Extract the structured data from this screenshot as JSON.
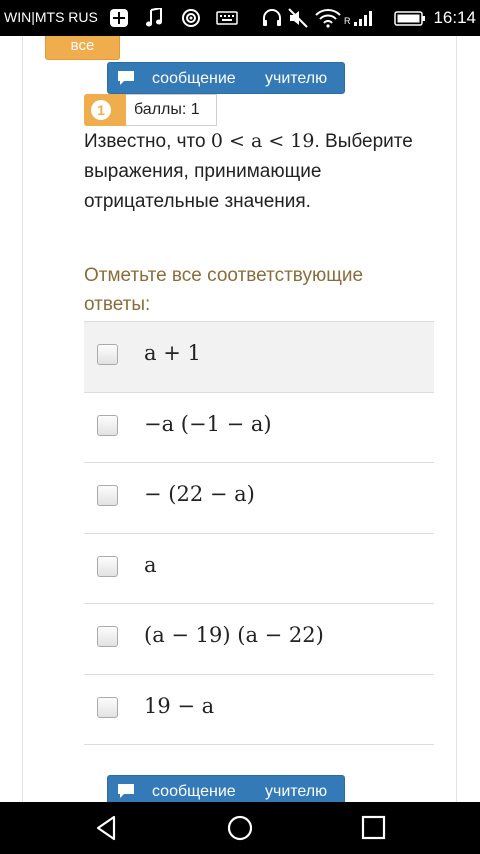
{
  "status_bar": {
    "carrier": "WIN|MTS RUS",
    "time": "16:14",
    "icons": [
      "add-icon",
      "music-icon",
      "target-icon",
      "keyboard-icon",
      "headphones-icon",
      "mute-icon",
      "wifi-icon",
      "signal-icon",
      "battery-icon"
    ]
  },
  "toolbar": {
    "all_label": "все"
  },
  "message_button": {
    "word1": "сообщение",
    "word2": "учителю",
    "icon": "comment-icon"
  },
  "question": {
    "number": "1",
    "points": "баллы: 1",
    "text_before": "Известно, что ",
    "condition": "0 < a < 19",
    "text_after": ". Выберите выражения, принимающие отрицательные значения."
  },
  "instruction": "Отметьте все соответствующие ответы:",
  "answers": [
    {
      "label": "a + 1",
      "checked": false
    },
    {
      "label": "−a (−1 − a)",
      "checked": false
    },
    {
      "label": "− (22 − a)",
      "checked": false
    },
    {
      "label": "a",
      "checked": false
    },
    {
      "label": "(a − 19) (a − 22)",
      "checked": false
    },
    {
      "label": "19 − a",
      "checked": false
    }
  ],
  "nav_bar": {
    "icons": [
      "back-icon",
      "home-icon",
      "recents-icon"
    ]
  },
  "colors": {
    "accent_orange": "#f0ad4e",
    "primary_blue": "#337ab7",
    "instruction_text": "#8a6d3b"
  }
}
